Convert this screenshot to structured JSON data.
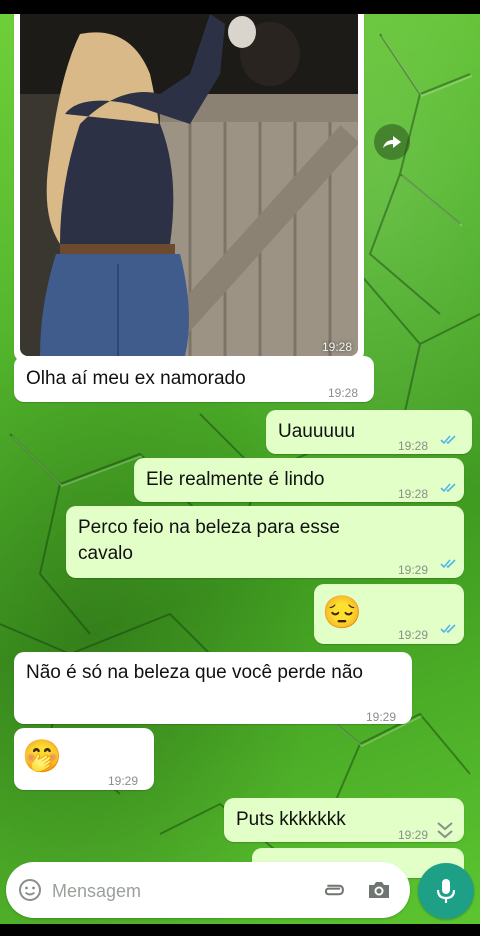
{
  "messages": [
    {
      "direction": "in",
      "type": "image",
      "time": "19:28"
    },
    {
      "direction": "in",
      "text": "Olha aí meu ex namorado",
      "time": "19:28"
    },
    {
      "direction": "out",
      "text": "Uauuuuu",
      "time": "19:28",
      "status": "read"
    },
    {
      "direction": "out",
      "text": "Ele realmente é lindo",
      "time": "19:28",
      "status": "read"
    },
    {
      "direction": "out",
      "text": "Perco feio na beleza para esse cavalo",
      "time": "19:29",
      "status": "read"
    },
    {
      "direction": "out",
      "text": "😔",
      "time": "19:29",
      "status": "read"
    },
    {
      "direction": "in",
      "text": "Não é só na beleza que você perde não",
      "time": "19:29"
    },
    {
      "direction": "in",
      "text": "🤭",
      "time": "19:29"
    },
    {
      "direction": "out",
      "text": "Puts kkkkkkk",
      "time": "19:29",
      "status": "read"
    }
  ],
  "composer": {
    "placeholder": "Mensagem"
  },
  "icons": {
    "forward": "forward-icon",
    "emoji": "emoji-icon",
    "attach": "paperclip-icon",
    "camera": "camera-icon",
    "mic": "mic-icon",
    "scroll_down": "chevron-down-icon"
  },
  "colors": {
    "incoming_bubble": "#ffffff",
    "outgoing_bubble": "#e2ffc8",
    "read_ticks": "#4fb6ec",
    "mic_button": "#1ea087"
  }
}
